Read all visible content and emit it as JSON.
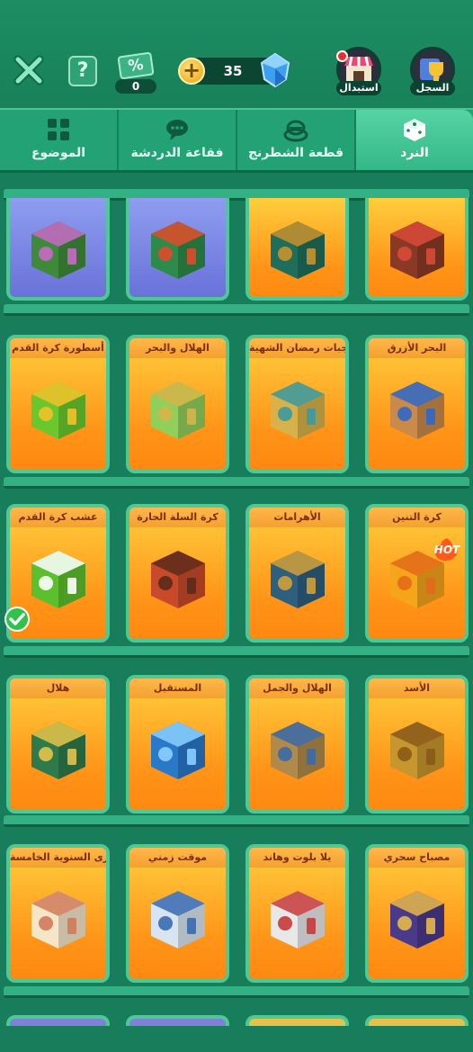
{
  "header": {
    "coupon_icon": "coupon-percent-icon",
    "coupon_symbol": "%",
    "coupon_count": "0",
    "help_symbol": "?",
    "gems": "35",
    "add_symbol": "+",
    "exchange_label": "استبدال",
    "record_label": "السجل"
  },
  "tabs": [
    {
      "label": "الموضوع",
      "icon": "theme-grid-icon"
    },
    {
      "label": "فقاعة الدردشة",
      "icon": "chat-bubble-icon"
    },
    {
      "label": "قطعة الشطرنج",
      "icon": "chess-piece-icon"
    },
    {
      "label": "النرد",
      "icon": "dice-icon"
    }
  ],
  "items": [
    {
      "title": "",
      "color": "orange"
    },
    {
      "title": "",
      "color": "orange"
    },
    {
      "title": "",
      "color": "purple"
    },
    {
      "title": "",
      "color": "purple"
    },
    {
      "title": "البحر الأزرق",
      "color": "orange"
    },
    {
      "title": "وجبات رمضان الشهية",
      "color": "orange"
    },
    {
      "title": "الهلال والبحر",
      "color": "orange"
    },
    {
      "title": "أسطورة كرة القدم",
      "color": "orange"
    },
    {
      "title": "كرة التنين",
      "color": "orange",
      "badge": "HOT",
      "selected": true
    },
    {
      "title": "الأهرامات",
      "color": "orange"
    },
    {
      "title": "كرة السلة الحارة",
      "color": "orange"
    },
    {
      "title": "عشب كرة القدم",
      "color": "orange"
    },
    {
      "title": "الأسد",
      "color": "orange"
    },
    {
      "title": "الهلال والجمل",
      "color": "orange"
    },
    {
      "title": "المستقبل",
      "color": "orange"
    },
    {
      "title": "هلال",
      "color": "orange"
    },
    {
      "title": "مصباح سحري",
      "color": "orange"
    },
    {
      "title": "يلا بلوت وهاند",
      "color": "orange"
    },
    {
      "title": "موقت زمني",
      "color": "orange"
    },
    {
      "title": "الذكرى السنوية الخامسة",
      "color": "orange"
    }
  ],
  "colors": {
    "accent": "#4cc995",
    "background": "#177d5a",
    "card_orange": "#ff9418"
  }
}
